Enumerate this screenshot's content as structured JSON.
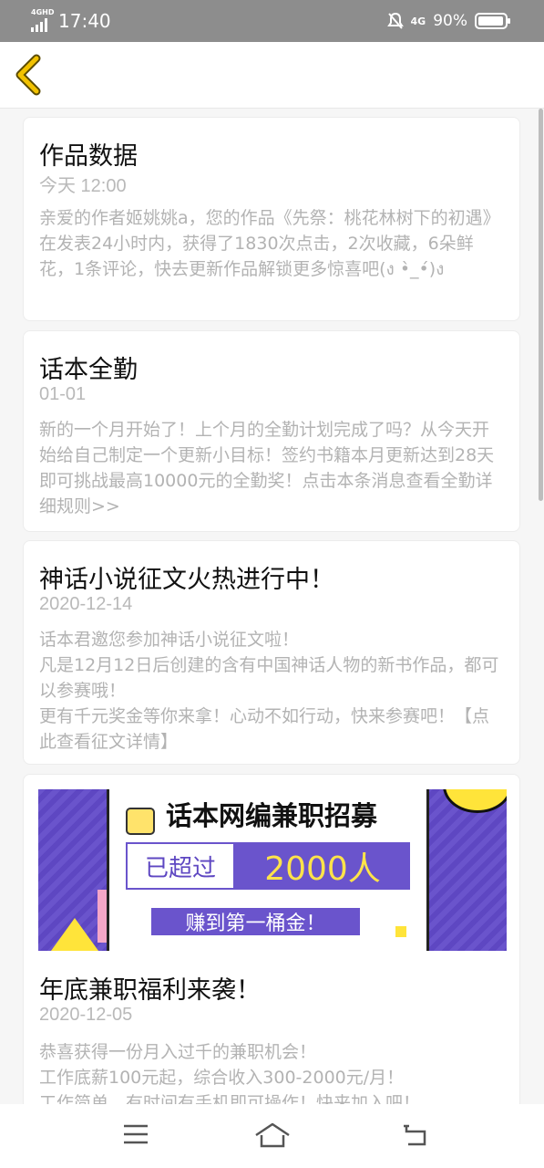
{
  "status_bar": {
    "network": "4GHD",
    "time": "17:40",
    "signal_right": "4G",
    "battery": "90%"
  },
  "messages": [
    {
      "title": "作品数据",
      "date": "今天 12:00",
      "body": "亲爱的作者姬姚姚a，您的作品《先祭：桃花林树下的初遇》在发表24小时内，获得了1830次点击，2次收藏，6朵鲜花，1条评论，快去更新作品解锁更多惊喜吧(ง •̀_•́)ง"
    },
    {
      "title": "话本全勤",
      "date": "01-01",
      "body": "新的一个月开始了！上个月的全勤计划完成了吗？从今天开始给自己制定一个更新小目标！签约书籍本月更新达到28天 即可挑战最高10000元的全勤奖！点击本条消息查看全勤详细规则>>"
    },
    {
      "title": "神话小说征文火热进行中！",
      "date": "2020-12-14",
      "body": "话本君邀您参加神话小说征文啦！\n凡是12月12日后创建的含有中国神话人物的新书作品，都可以参赛哦！\n更有千元奖金等你来拿！心动不如行动，快来参赛吧！【点此查看征文详情】"
    },
    {
      "title": "年底兼职福利来袭！",
      "date": "2020-12-05",
      "body": "恭喜获得一份月入过千的兼职机会！\n工作底薪100元起，综合收入300-2000元/月！\n工作简单，有时间有手机即可操作！快来加入吧！",
      "banner": {
        "heading": "话本网编兼职招募",
        "left_text": "已超过",
        "highlight": "2000人",
        "sub": "赚到第一桶金！"
      }
    }
  ],
  "colors": {
    "accent_back": "#f2c200",
    "banner_purple": "#6a54cc",
    "banner_yellow": "#ffe34a"
  }
}
